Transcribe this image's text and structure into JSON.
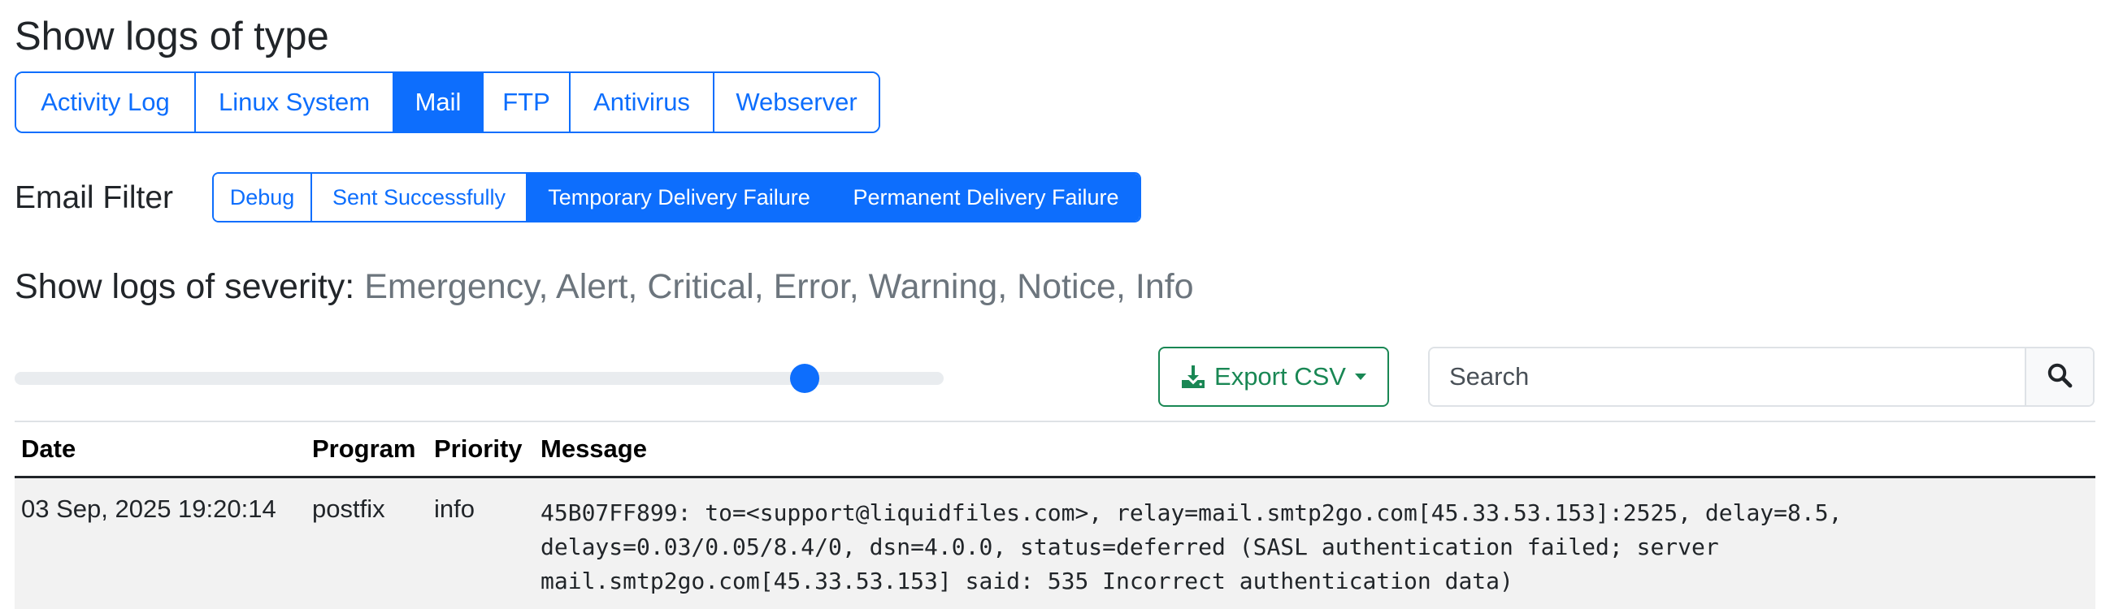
{
  "headings": {
    "log_type": "Show logs of type",
    "email_filter": "Email Filter",
    "severity_label": "Show logs of severity:",
    "severity_values": "Emergency, Alert, Critical, Error, Warning, Notice, Info"
  },
  "log_types": [
    {
      "label": "Activity Log",
      "active": false
    },
    {
      "label": "Linux System",
      "active": false
    },
    {
      "label": "Mail",
      "active": true
    },
    {
      "label": "FTP",
      "active": false
    },
    {
      "label": "Antivirus",
      "active": false
    },
    {
      "label": "Webserver",
      "active": false
    }
  ],
  "email_filters": [
    {
      "label": "Debug",
      "active": false
    },
    {
      "label": "Sent Successfully",
      "active": false
    },
    {
      "label": "Temporary Delivery Failure",
      "active": true
    },
    {
      "label": "Permanent Delivery Failure",
      "active": true
    }
  ],
  "severity_slider": {
    "fraction": 0.85
  },
  "toolbar": {
    "export_label": "Export CSV",
    "search_placeholder": "Search"
  },
  "table": {
    "columns": [
      "Date",
      "Program",
      "Priority",
      "Message"
    ],
    "rows": [
      {
        "date": "03 Sep, 2025 19:20:14",
        "program": "postfix",
        "priority": "info",
        "message": "45B07FF899: to=<support@liquidfiles.com>, relay=mail.smtp2go.com[45.33.53.153]:2525, delay=8.5, delays=0.03/0.05/8.4/0, dsn=4.0.0, status=deferred (SASL authentication failed; server mail.smtp2go.com[45.33.53.153] said: 535 Incorrect authentication data)"
      }
    ]
  },
  "colors": {
    "primary": "#0d6efd",
    "success": "#198754",
    "muted": "#6c757d",
    "row_stripe": "#f2f2f2"
  },
  "icons": {
    "export": "download-icon",
    "export_caret": "caret-down-icon",
    "search": "search-icon"
  }
}
